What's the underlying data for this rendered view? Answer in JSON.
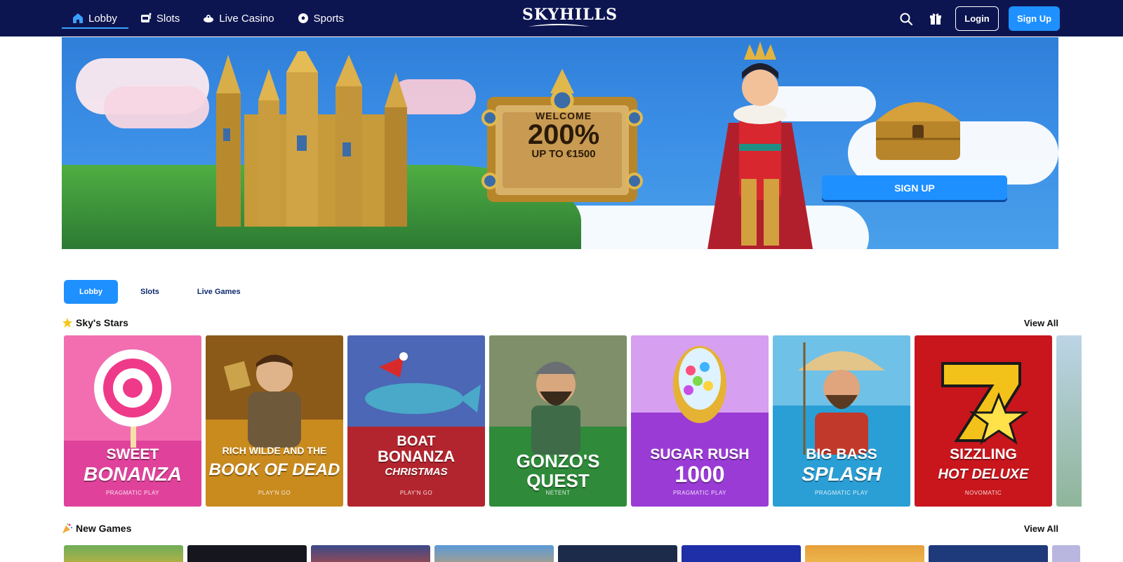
{
  "header": {
    "nav": [
      {
        "label": "Lobby",
        "icon": "home-icon",
        "active": true
      },
      {
        "label": "Slots",
        "icon": "slot-machine-icon"
      },
      {
        "label": "Live Casino",
        "icon": "chip-icon"
      },
      {
        "label": "Sports",
        "icon": "soccer-ball-icon"
      }
    ],
    "logo_text": "SKYHILLS",
    "login_label": "Login",
    "signup_label": "Sign Up"
  },
  "hero": {
    "welcome": "WELCOME",
    "percent": "200%",
    "upto": "UP TO €1500",
    "cta": "SIGN UP"
  },
  "tabs": [
    {
      "label": "Lobby",
      "active": true
    },
    {
      "label": "Slots"
    },
    {
      "label": "Live Games"
    }
  ],
  "sections": {
    "stars": {
      "title": "Sky's Stars",
      "view_all": "View All",
      "icon": "star-icon"
    },
    "new": {
      "title": "New Games",
      "view_all": "View All",
      "icon": "party-icon"
    }
  },
  "games": [
    {
      "line1": "SWEET",
      "line2": "BONANZA",
      "provider": "PRAGMATIC PLAY",
      "bg": "#f05fa8"
    },
    {
      "line1": "RICH WILDE AND THE",
      "line2": "BOOK OF DEAD",
      "provider": "PLAY'N GO",
      "bg": "#c98a1e"
    },
    {
      "line1": "BOAT",
      "line2": "BONANZA",
      "line3": "CHRISTMAS",
      "provider": "PLAY'N GO",
      "bg": "#b3252e"
    },
    {
      "line1": "GONZO'S QUEST",
      "line2": "",
      "provider": "NETENT",
      "bg": "#2f8a3a"
    },
    {
      "line1": "SUGAR RUSH",
      "line2": "1000",
      "provider": "PRAGMATIC PLAY",
      "bg": "#9a3bd6"
    },
    {
      "line1": "BIG BASS",
      "line2": "SPLASH",
      "provider": "PRAGMATIC PLAY",
      "bg": "#2a9fd6"
    },
    {
      "line1": "SIZZLING",
      "line2": "HOT DELUXE",
      "provider": "NOVOMATIC",
      "bg": "#c8161c"
    }
  ]
}
